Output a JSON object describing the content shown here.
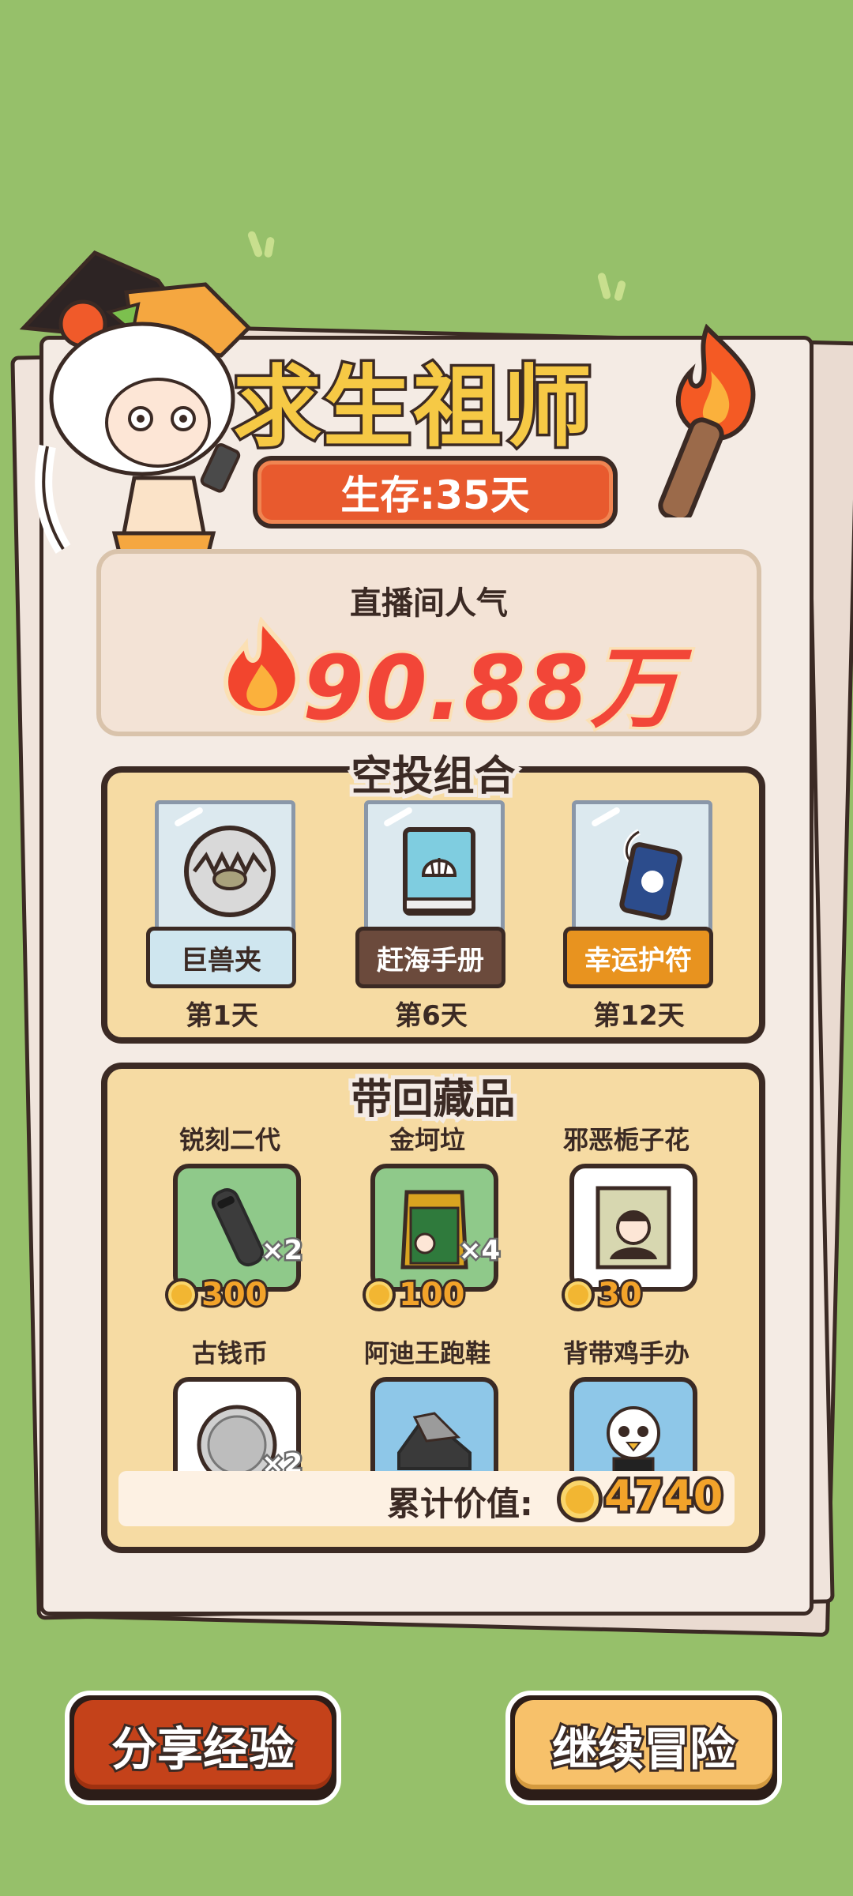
{
  "header": {
    "title": "求生祖师",
    "survive_label": "生存:35天"
  },
  "popularity": {
    "label": "直播间人气",
    "value": "90.88万"
  },
  "airdrop": {
    "title": "空投组合",
    "items": [
      {
        "name": "巨兽夹",
        "day": "第1天",
        "icon": "bear-trap-icon",
        "label_bg": "#cfe6ef",
        "label_color": "#3b2a24"
      },
      {
        "name": "赶海手册",
        "day": "第6天",
        "icon": "seashell-book-icon",
        "label_bg": "#6b4a3c",
        "label_color": "#ffffff"
      },
      {
        "name": "幸运护符",
        "day": "第12天",
        "icon": "luck-charm-icon",
        "label_bg": "#e8931f",
        "label_color": "#ffffff"
      }
    ]
  },
  "collection": {
    "title": "带回藏品",
    "items": [
      {
        "name": "锐刻二代",
        "price": "300",
        "mult": "×2",
        "icon": "vape-device-icon",
        "bg": "#8fc98a"
      },
      {
        "name": "金坷垃",
        "price": "100",
        "mult": "×4",
        "icon": "fertilizer-bag-icon",
        "bg": "#8fc98a"
      },
      {
        "name": "邪恶栀子花",
        "price": "30",
        "mult": "",
        "icon": "poster-card-icon",
        "bg": "#ffffff"
      },
      {
        "name": "古钱币",
        "price": "",
        "mult": "×2",
        "icon": "old-coin-icon",
        "bg": "#ffffff"
      },
      {
        "name": "阿迪王跑鞋",
        "price": "",
        "mult": "",
        "icon": "sneaker-icon",
        "bg": "#8ec7e8"
      },
      {
        "name": "背带鸡手办",
        "price": "",
        "mult": "",
        "icon": "chicken-figure-icon",
        "bg": "#8ec7e8"
      }
    ],
    "total_label": "累计价值:",
    "total_value": "4740"
  },
  "buttons": {
    "share": "分享经验",
    "continue": "继续冒险"
  }
}
